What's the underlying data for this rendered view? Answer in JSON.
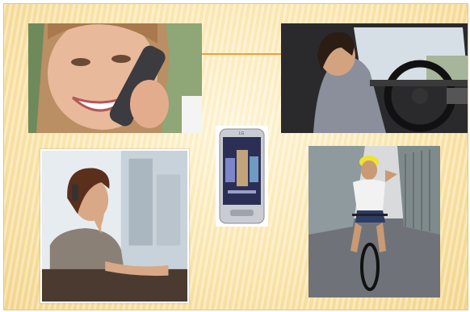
{
  "slide": {
    "background": "#fbe6ad",
    "accent_color": "#e9a23b"
  },
  "photos": [
    {
      "id": "photo-girl",
      "icon": "girl-on-phone-photo"
    },
    {
      "id": "photo-driver",
      "icon": "driver-on-phone-photo"
    },
    {
      "id": "photo-phone",
      "icon": "touchscreen-phone-photo",
      "brand": "LG"
    },
    {
      "id": "photo-woman",
      "icon": "woman-at-desk-on-phone-photo"
    },
    {
      "id": "photo-cyclist",
      "icon": "cyclist-on-phone-photo"
    }
  ]
}
